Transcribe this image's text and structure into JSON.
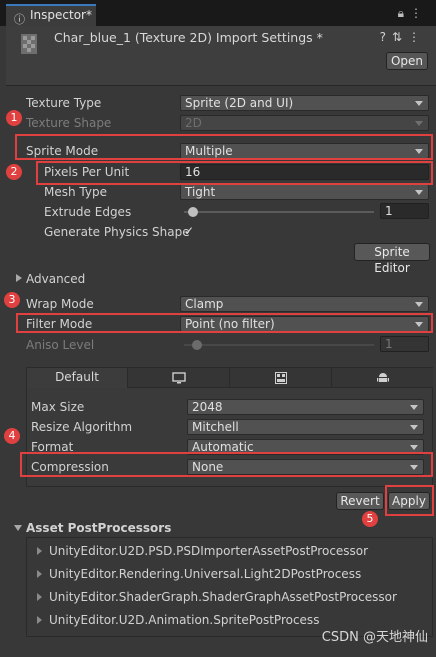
{
  "tab": {
    "title": "Inspector*"
  },
  "header": {
    "title": "Char_blue_1 (Texture 2D) Import Settings *",
    "open_label": "Open",
    "icons": [
      "help-icon",
      "presets-icon",
      "more-icon"
    ]
  },
  "fields": {
    "texture_type": {
      "label": "Texture Type",
      "value": "Sprite (2D and UI)"
    },
    "texture_shape": {
      "label": "Texture Shape",
      "value": "2D"
    },
    "sprite_mode": {
      "label": "Sprite Mode",
      "value": "Multiple"
    },
    "pixels_per_unit": {
      "label": "Pixels Per Unit",
      "value": "16"
    },
    "mesh_type": {
      "label": "Mesh Type",
      "value": "Tight"
    },
    "extrude_edges": {
      "label": "Extrude Edges",
      "value": "1"
    },
    "generate_physics": {
      "label": "Generate Physics Shape",
      "checked": true
    },
    "sprite_editor_label": "Sprite Editor",
    "advanced_label": "Advanced",
    "wrap_mode": {
      "label": "Wrap Mode",
      "value": "Clamp"
    },
    "filter_mode": {
      "label": "Filter Mode",
      "value": "Point (no filter)"
    },
    "aniso_level": {
      "label": "Aniso Level",
      "value": "1"
    }
  },
  "platform": {
    "tabs": [
      {
        "label": "Default",
        "icon": ""
      },
      {
        "label": "",
        "icon": "monitor-icon"
      },
      {
        "label": "",
        "icon": "webgl-icon"
      },
      {
        "label": "",
        "icon": "android-icon"
      }
    ],
    "max_size": {
      "label": "Max Size",
      "value": "2048"
    },
    "resize_algorithm": {
      "label": "Resize Algorithm",
      "value": "Mitchell"
    },
    "format": {
      "label": "Format",
      "value": "Automatic"
    },
    "compression": {
      "label": "Compression",
      "value": "None"
    }
  },
  "actions": {
    "revert_label": "Revert",
    "apply_label": "Apply"
  },
  "postprocessors": {
    "title": "Asset PostProcessors",
    "items": [
      "UnityEditor.U2D.PSD.PSDImporterAssetPostProcessor",
      "UnityEditor.Rendering.Universal.Light2DPostProcess",
      "UnityEditor.ShaderGraph.ShaderGraphAssetPostProcessor",
      "UnityEditor.U2D.Animation.SpritePostProcess"
    ]
  },
  "annotations": [
    "1",
    "2",
    "3",
    "4",
    "5"
  ],
  "watermark": "CSDN @天地神仙",
  "colors": {
    "highlight_red": "#e0403f",
    "tab_accent": "#3a79bb"
  }
}
